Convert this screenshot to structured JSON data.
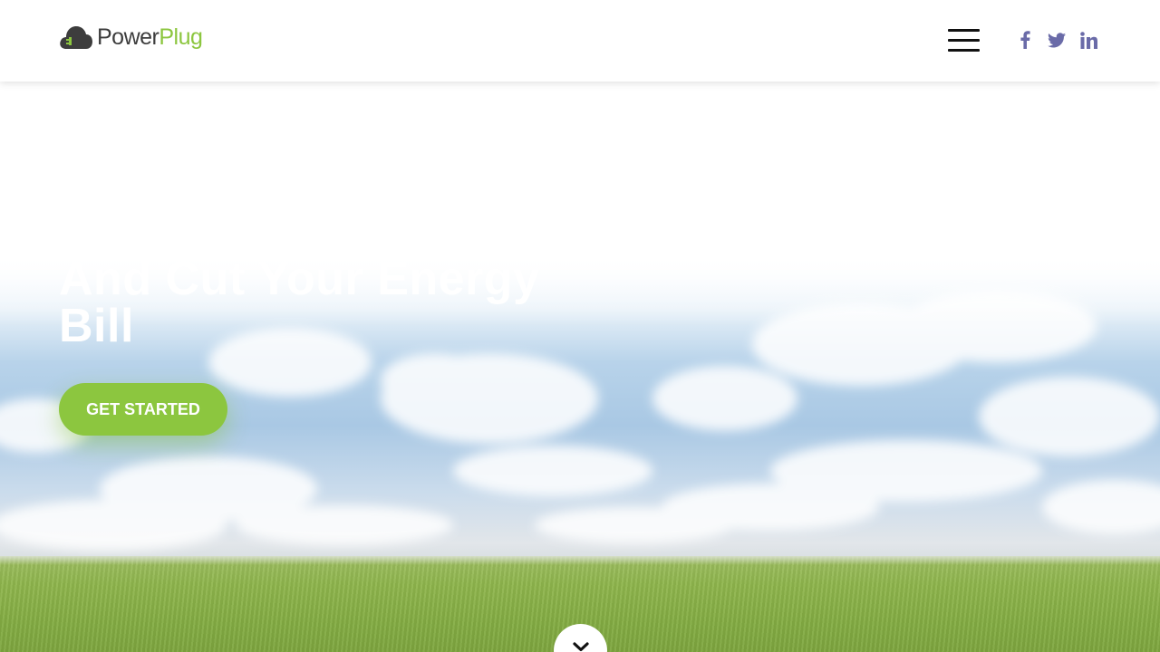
{
  "brand": {
    "name_part1": "Power",
    "name_part2": "Plug",
    "dark_color": "#3d3d3d",
    "accent_color": "#8cc63f"
  },
  "header": {
    "menu_icon": "hamburger-menu-icon",
    "social": [
      {
        "name": "facebook-icon",
        "color": "#6a6ba8"
      },
      {
        "name": "twitter-icon",
        "color": "#6a6ba8"
      },
      {
        "name": "linkedin-icon",
        "color": "#6a6ba8"
      }
    ]
  },
  "hero": {
    "headline_line1": "And Cut Your Energy",
    "headline_line2": "Bill",
    "cta_label": "GET STARTED",
    "scroll_icon": "chevron-down-icon"
  }
}
